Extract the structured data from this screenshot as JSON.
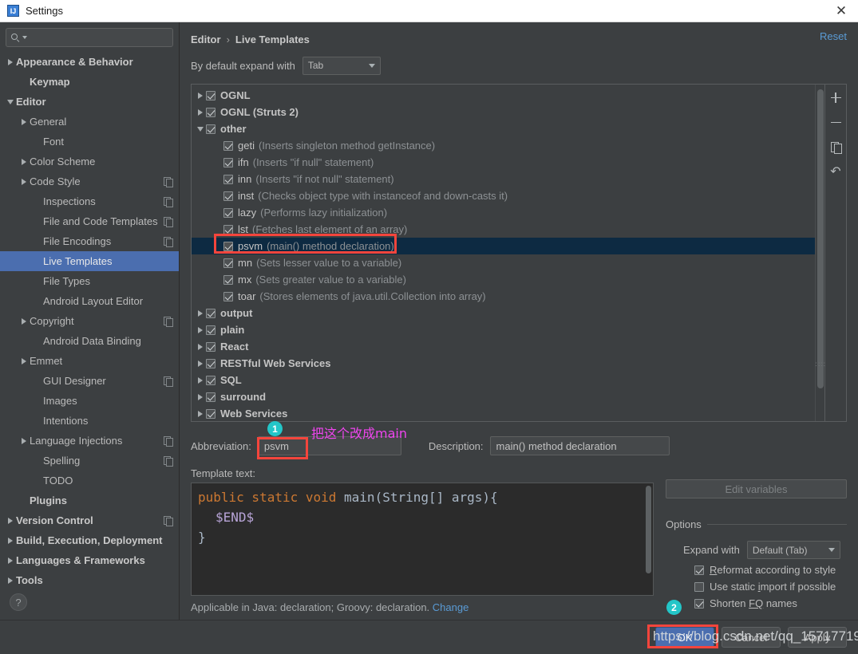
{
  "window": {
    "title": "Settings",
    "app_icon": "IJ",
    "close_icon": "✕"
  },
  "search": {
    "value": "",
    "placeholder": "",
    "icon": "search-icon"
  },
  "sidebar": {
    "items": [
      {
        "label": "Appearance & Behavior",
        "indent": 0,
        "arrow": "right",
        "bold": true,
        "copy": false,
        "selected": false
      },
      {
        "label": "Keymap",
        "indent": 1,
        "arrow": "none",
        "bold": true,
        "copy": false,
        "selected": false
      },
      {
        "label": "Editor",
        "indent": 0,
        "arrow": "down",
        "bold": true,
        "copy": false,
        "selected": false
      },
      {
        "label": "General",
        "indent": 1,
        "arrow": "right",
        "bold": false,
        "copy": false,
        "selected": false
      },
      {
        "label": "Font",
        "indent": 2,
        "arrow": "none",
        "bold": false,
        "copy": false,
        "selected": false
      },
      {
        "label": "Color Scheme",
        "indent": 1,
        "arrow": "right",
        "bold": false,
        "copy": false,
        "selected": false
      },
      {
        "label": "Code Style",
        "indent": 1,
        "arrow": "right",
        "bold": false,
        "copy": true,
        "selected": false
      },
      {
        "label": "Inspections",
        "indent": 2,
        "arrow": "none",
        "bold": false,
        "copy": true,
        "selected": false
      },
      {
        "label": "File and Code Templates",
        "indent": 2,
        "arrow": "none",
        "bold": false,
        "copy": true,
        "selected": false
      },
      {
        "label": "File Encodings",
        "indent": 2,
        "arrow": "none",
        "bold": false,
        "copy": true,
        "selected": false
      },
      {
        "label": "Live Templates",
        "indent": 2,
        "arrow": "none",
        "bold": false,
        "copy": false,
        "selected": true
      },
      {
        "label": "File Types",
        "indent": 2,
        "arrow": "none",
        "bold": false,
        "copy": false,
        "selected": false
      },
      {
        "label": "Android Layout Editor",
        "indent": 2,
        "arrow": "none",
        "bold": false,
        "copy": false,
        "selected": false
      },
      {
        "label": "Copyright",
        "indent": 1,
        "arrow": "right",
        "bold": false,
        "copy": true,
        "selected": false
      },
      {
        "label": "Android Data Binding",
        "indent": 2,
        "arrow": "none",
        "bold": false,
        "copy": false,
        "selected": false
      },
      {
        "label": "Emmet",
        "indent": 1,
        "arrow": "right",
        "bold": false,
        "copy": false,
        "selected": false
      },
      {
        "label": "GUI Designer",
        "indent": 2,
        "arrow": "none",
        "bold": false,
        "copy": true,
        "selected": false
      },
      {
        "label": "Images",
        "indent": 2,
        "arrow": "none",
        "bold": false,
        "copy": false,
        "selected": false
      },
      {
        "label": "Intentions",
        "indent": 2,
        "arrow": "none",
        "bold": false,
        "copy": false,
        "selected": false
      },
      {
        "label": "Language Injections",
        "indent": 1,
        "arrow": "right",
        "bold": false,
        "copy": true,
        "selected": false
      },
      {
        "label": "Spelling",
        "indent": 2,
        "arrow": "none",
        "bold": false,
        "copy": true,
        "selected": false
      },
      {
        "label": "TODO",
        "indent": 2,
        "arrow": "none",
        "bold": false,
        "copy": false,
        "selected": false
      },
      {
        "label": "Plugins",
        "indent": 1,
        "arrow": "none",
        "bold": true,
        "copy": false,
        "selected": false
      },
      {
        "label": "Version Control",
        "indent": 0,
        "arrow": "right",
        "bold": true,
        "copy": true,
        "selected": false
      },
      {
        "label": "Build, Execution, Deployment",
        "indent": 0,
        "arrow": "right",
        "bold": true,
        "copy": false,
        "selected": false
      },
      {
        "label": "Languages & Frameworks",
        "indent": 0,
        "arrow": "right",
        "bold": true,
        "copy": false,
        "selected": false
      },
      {
        "label": "Tools",
        "indent": 0,
        "arrow": "right",
        "bold": true,
        "copy": false,
        "selected": false
      }
    ],
    "help_icon": "?"
  },
  "main": {
    "breadcrumb": {
      "parent": "Editor",
      "separator": "›",
      "current": "Live Templates"
    },
    "reset_label": "Reset",
    "expand_label": "By default expand with",
    "expand_value": "Tab",
    "toolbar": {
      "add": "+",
      "remove": "−",
      "duplicate": "duplicate-icon",
      "revert": "↶"
    },
    "tree": [
      {
        "type": "group",
        "name": "OGNL",
        "arrow": "right",
        "checked": true,
        "desc": "",
        "selected": false
      },
      {
        "type": "group",
        "name": "OGNL (Struts 2)",
        "arrow": "right",
        "checked": true,
        "desc": "",
        "selected": false
      },
      {
        "type": "group",
        "name": "other",
        "arrow": "down",
        "checked": true,
        "desc": "",
        "selected": false
      },
      {
        "type": "child",
        "name": "geti",
        "checked": true,
        "desc": "(Inserts singleton method getInstance)",
        "selected": false
      },
      {
        "type": "child",
        "name": "ifn",
        "checked": true,
        "desc": "(Inserts \"if null\" statement)",
        "selected": false
      },
      {
        "type": "child",
        "name": "inn",
        "checked": true,
        "desc": "(Inserts \"if not null\" statement)",
        "selected": false
      },
      {
        "type": "child",
        "name": "inst",
        "checked": true,
        "desc": "(Checks object type with instanceof and down-casts it)",
        "selected": false
      },
      {
        "type": "child",
        "name": "lazy",
        "checked": true,
        "desc": "(Performs lazy initialization)",
        "selected": false
      },
      {
        "type": "child",
        "name": "lst",
        "checked": true,
        "desc": "(Fetches last element of an array)",
        "selected": false
      },
      {
        "type": "child",
        "name": "psvm",
        "checked": true,
        "desc": "(main() method declaration)",
        "selected": true
      },
      {
        "type": "child",
        "name": "mn",
        "checked": true,
        "desc": "(Sets lesser value to a variable)",
        "selected": false
      },
      {
        "type": "child",
        "name": "mx",
        "checked": true,
        "desc": "(Sets greater value to a variable)",
        "selected": false
      },
      {
        "type": "child",
        "name": "toar",
        "checked": true,
        "desc": "(Stores elements of java.util.Collection into array)",
        "selected": false
      },
      {
        "type": "group",
        "name": "output",
        "arrow": "right",
        "checked": true,
        "desc": "",
        "selected": false
      },
      {
        "type": "group",
        "name": "plain",
        "arrow": "right",
        "checked": true,
        "desc": "",
        "selected": false
      },
      {
        "type": "group",
        "name": "React",
        "arrow": "right",
        "checked": true,
        "desc": "",
        "selected": false
      },
      {
        "type": "group",
        "name": "RESTful Web Services",
        "arrow": "right",
        "checked": true,
        "desc": "",
        "selected": false
      },
      {
        "type": "group",
        "name": "SQL",
        "arrow": "right",
        "checked": true,
        "desc": "",
        "selected": false
      },
      {
        "type": "group",
        "name": "surround",
        "arrow": "right",
        "checked": true,
        "desc": "",
        "selected": false
      },
      {
        "type": "group",
        "name": "Web Services",
        "arrow": "right",
        "checked": true,
        "desc": "",
        "selected": false
      }
    ],
    "abbreviation_label": "Abbreviation:",
    "abbreviation_value": "psvm",
    "description_label": "Description:",
    "description_value": "main() method declaration",
    "template_text_label": "Template text:",
    "template_code": {
      "line1_kw": "public static void ",
      "line1_rest": "main(String[] args){",
      "line2": "$END$",
      "line3": "}"
    },
    "applicable_text": "Applicable in Java: declaration; Groovy: declaration.",
    "applicable_change": "Change",
    "edit_variables_label": "Edit variables",
    "options_label": "Options",
    "options_expand_label": "Expand with",
    "options_expand_value": "Default (Tab)",
    "options_checkboxes": [
      {
        "pre": "",
        "accel": "R",
        "post": "eformat according to style",
        "checked": true
      },
      {
        "pre": "Use static ",
        "accel": "i",
        "post": "mport if possible",
        "checked": false
      },
      {
        "pre": "Shorten ",
        "accel": "FQ",
        "post": " names",
        "checked": true
      }
    ]
  },
  "footer": {
    "ok_label": "OK",
    "cancel_label": "Cancel",
    "apply_label": "Apply"
  },
  "annotations": {
    "badge1": "1",
    "badge2": "2",
    "note1": "把这个改成main",
    "watermark": "https://blog.csdn.net/qq_15717719",
    "box_color": "#f4453c",
    "badge_color": "#23c6c8",
    "note_color": "#ef45ef"
  }
}
